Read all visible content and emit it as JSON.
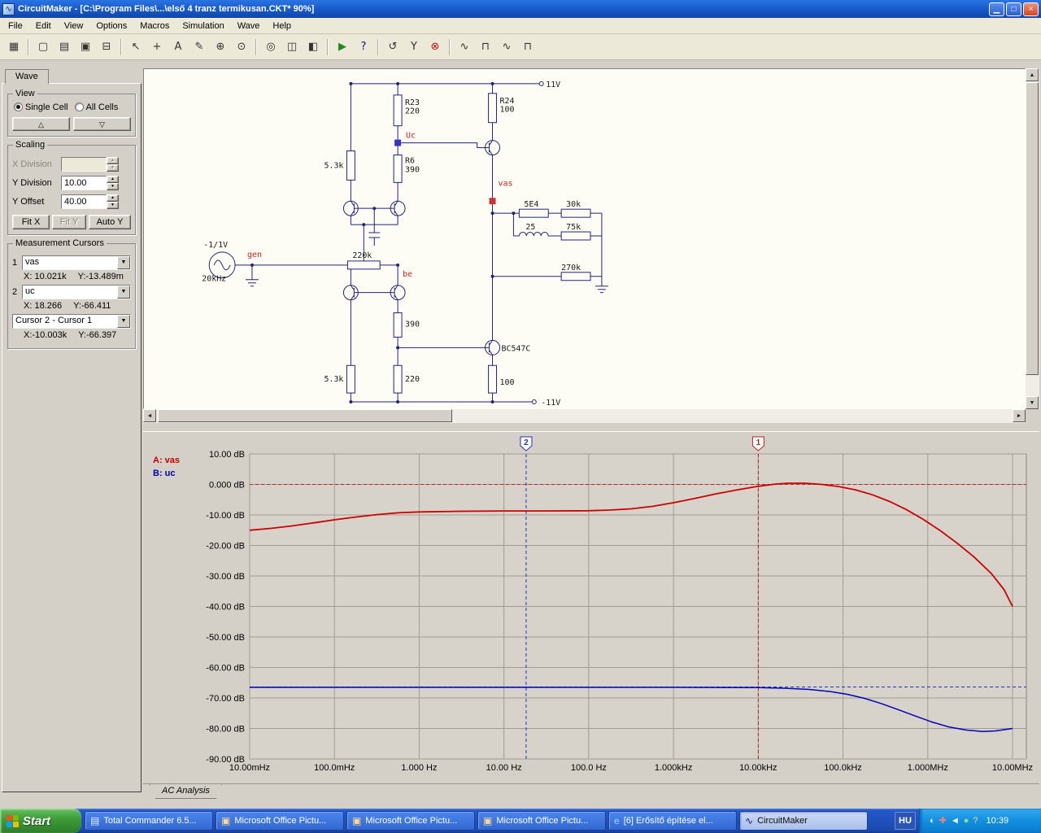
{
  "window": {
    "title": "CircuitMaker - [C:\\Program Files\\...\\első 4 tranz termikusan.CKT* 90%]",
    "minimize_glyph": "▁",
    "maximize_glyph": "□",
    "close_glyph": "×",
    "app_icon_glyph": "∿"
  },
  "menu": {
    "items": [
      "File",
      "Edit",
      "View",
      "Options",
      "Macros",
      "Simulation",
      "Wave",
      "Help"
    ]
  },
  "toolbar": {
    "buttons": [
      {
        "name": "board",
        "glyph": "▦"
      },
      {
        "sep": true
      },
      {
        "name": "new-file",
        "glyph": "▢"
      },
      {
        "name": "open-file",
        "glyph": "▤"
      },
      {
        "name": "save-file",
        "glyph": "▣"
      },
      {
        "name": "print",
        "glyph": "⊟"
      },
      {
        "sep": true
      },
      {
        "name": "select-arrow",
        "glyph": "↖"
      },
      {
        "name": "wire-tool",
        "glyph": "+"
      },
      {
        "name": "text-tool",
        "glyph": "A"
      },
      {
        "name": "edit-tool",
        "glyph": "✎"
      },
      {
        "name": "zoom-in-tool",
        "glyph": "⊕"
      },
      {
        "name": "zoom-tool",
        "glyph": "⊙"
      },
      {
        "sep": true
      },
      {
        "name": "find-part",
        "glyph": "◎"
      },
      {
        "name": "page-view",
        "glyph": "◫"
      },
      {
        "name": "split-view",
        "glyph": "◧"
      },
      {
        "sep": true
      },
      {
        "name": "run-simulation",
        "glyph": "▶",
        "color": "#1f8a1f"
      },
      {
        "name": "help",
        "glyph": "?",
        "color": "#14138a"
      },
      {
        "sep": true
      },
      {
        "name": "reset-simulation",
        "glyph": "↺"
      },
      {
        "name": "probe-y",
        "glyph": "Y"
      },
      {
        "name": "stop-simulation",
        "glyph": "⊗",
        "color": "#cc1111"
      },
      {
        "sep": true
      },
      {
        "name": "waveform-analog",
        "glyph": "∿"
      },
      {
        "name": "waveform-digital",
        "glyph": "⊓"
      },
      {
        "name": "waveform-mixed",
        "glyph": "∿"
      },
      {
        "name": "waveform-scope",
        "glyph": "⊓"
      }
    ]
  },
  "sidebar": {
    "tab_label": "Wave",
    "view": {
      "title": "View",
      "single_cell": "Single Cell",
      "all_cells": "All Cells",
      "up_glyph": "△",
      "down_glyph": "▽"
    },
    "scaling": {
      "title": "Scaling",
      "x_division_label": "X Division",
      "x_division_value": "",
      "y_division_label": "Y Division",
      "y_division_value": "10.00",
      "y_offset_label": "Y Offset",
      "y_offset_value": "40.00",
      "fit_x": "Fit X",
      "fit_y": "Fit Y",
      "auto_y": "Auto Y",
      "spin_up_glyph": "▲",
      "spin_down_glyph": "▼"
    },
    "cursors": {
      "title": "Measurement Cursors",
      "c1_index": "1",
      "c1_signal": "vas",
      "c1_x": "X: 10.021k",
      "c1_y": "Y:-13.489m",
      "c2_index": "2",
      "c2_signal": "uc",
      "c2_x": "X: 18.266",
      "c2_y": "Y:-66.411",
      "diff_label": "Cursor 2 - Cursor 1",
      "diff_x": "X:-10.003k",
      "diff_y": "Y:-66.397",
      "combo_arrow_glyph": "▼"
    }
  },
  "circuit": {
    "labels": {
      "vcc": "11V",
      "vee": "-11V",
      "r23_name": "R23",
      "r23_value": "220",
      "r24_name": "R24",
      "r24_value": "100",
      "r6_name": "R6",
      "r6_value": "390",
      "r_in_top": "5.3k",
      "node_uc": "Uc",
      "node_vas": "vas",
      "node_gen": "gen",
      "node_be": "be",
      "gen_amplitude": "-1/1V",
      "gen_freq": "20kHz",
      "r_220k": "220k",
      "r_5e4": "5E4",
      "r_30k": "30k",
      "l_25": "25",
      "r_75k": "75k",
      "r_270k": "270k",
      "r_390": "390",
      "q_out": "BC547C",
      "r_bot_53k": "5.3k",
      "r_bot_220": "220",
      "r_bot_100": "100"
    }
  },
  "chart_data": {
    "type": "line",
    "title": "AC Analysis frequency response",
    "x_scale": "log",
    "x_log_range": [
      -2,
      7
    ],
    "y_range_db": [
      -90,
      10
    ],
    "grid": true,
    "x_ticks": [
      "10.00mHz",
      "100.0mHz",
      "1.000 Hz",
      "10.00 Hz",
      "100.0 Hz",
      "1.000kHz",
      "10.00kHz",
      "100.0kHz",
      "1.000MHz",
      "10.00MHz"
    ],
    "y_ticks": [
      "10.00 dB",
      "0.000 dB",
      "-10.00 dB",
      "-20.00 dB",
      "-30.00 dB",
      "-40.00 dB",
      "-50.00 dB",
      "-60.00 dB",
      "-70.00 dB",
      "-80.00 dB",
      "-90.00 dB"
    ],
    "series": [
      {
        "name": "A: vas",
        "color": "#cc0000",
        "points": [
          [
            -2,
            -15.0
          ],
          [
            -1.75,
            -14.4
          ],
          [
            -1.5,
            -13.6
          ],
          [
            -1.25,
            -12.6
          ],
          [
            -1,
            -11.6
          ],
          [
            -0.75,
            -10.7
          ],
          [
            -0.5,
            -9.9
          ],
          [
            -0.25,
            -9.3
          ],
          [
            0,
            -9.0
          ],
          [
            0.5,
            -8.8
          ],
          [
            1,
            -8.7
          ],
          [
            1.5,
            -8.7
          ],
          [
            2,
            -8.6
          ],
          [
            2.25,
            -8.4
          ],
          [
            2.5,
            -8.0
          ],
          [
            2.75,
            -7.2
          ],
          [
            3,
            -6.0
          ],
          [
            3.25,
            -4.6
          ],
          [
            3.5,
            -3.1
          ],
          [
            3.75,
            -1.8
          ],
          [
            4,
            -0.6
          ],
          [
            4.2,
            0.1
          ],
          [
            4.35,
            0.4
          ],
          [
            4.55,
            0.4
          ],
          [
            4.75,
            0.0
          ],
          [
            4.95,
            -0.7
          ],
          [
            5.15,
            -1.8
          ],
          [
            5.35,
            -3.4
          ],
          [
            5.55,
            -5.6
          ],
          [
            5.75,
            -8.3
          ],
          [
            5.95,
            -11.5
          ],
          [
            6.15,
            -15.2
          ],
          [
            6.35,
            -19.3
          ],
          [
            6.55,
            -23.9
          ],
          [
            6.75,
            -29.2
          ],
          [
            6.9,
            -34.5
          ],
          [
            7,
            -40.0
          ]
        ]
      },
      {
        "name": "B: uc",
        "color": "#0000bb",
        "points": [
          [
            -2,
            -66.5
          ],
          [
            -1,
            -66.5
          ],
          [
            0,
            -66.5
          ],
          [
            1,
            -66.5
          ],
          [
            2,
            -66.5
          ],
          [
            3,
            -66.5
          ],
          [
            3.6,
            -66.55
          ],
          [
            4,
            -66.6
          ],
          [
            4.3,
            -66.8
          ],
          [
            4.6,
            -67.2
          ],
          [
            4.85,
            -67.9
          ],
          [
            5.05,
            -68.8
          ],
          [
            5.25,
            -70.1
          ],
          [
            5.45,
            -71.8
          ],
          [
            5.65,
            -73.8
          ],
          [
            5.85,
            -75.9
          ],
          [
            6.05,
            -77.9
          ],
          [
            6.25,
            -79.5
          ],
          [
            6.45,
            -80.5
          ],
          [
            6.65,
            -81.0
          ],
          [
            6.8,
            -80.8
          ],
          [
            7,
            -80.0
          ]
        ]
      }
    ],
    "cursors": [
      {
        "id": "2",
        "signal": "uc",
        "color": "#2233bb",
        "x_log": 1.2617,
        "y_db": -66.411
      },
      {
        "id": "1",
        "signal": "vas",
        "color": "#bb2222",
        "x_log": 4.0009,
        "y_db": -0.0135
      }
    ]
  },
  "plot": {
    "tab_label": "AC Analysis"
  },
  "taskbar": {
    "start_label": "Start",
    "buttons": [
      {
        "label": "Total Commander 6.5...",
        "icon": "▤",
        "icon_color": "#e8eef8"
      },
      {
        "label": "Microsoft Office Pictu...",
        "icon": "▣",
        "icon_color": "#ffd98a"
      },
      {
        "label": "Microsoft Office Pictu...",
        "icon": "▣",
        "icon_color": "#ffd98a"
      },
      {
        "label": "Microsoft Office Pictu...",
        "icon": "▣",
        "icon_color": "#ffd98a"
      },
      {
        "label": "[6] Erősítő építése el...",
        "icon": "e",
        "icon_color": "#9fd2ff"
      },
      {
        "label": "CircuitMaker",
        "icon": "∿",
        "icon_color": "#14138a",
        "active": true
      }
    ],
    "language": "HU",
    "tray_icons": [
      {
        "name": "display-icon",
        "glyph": "◐",
        "color": "#e8eef8"
      },
      {
        "name": "alert-icon",
        "glyph": "✚",
        "color": "#ff7b6b"
      },
      {
        "name": "volume-icon",
        "glyph": "◄",
        "color": "#ffffff"
      },
      {
        "name": "network-icon",
        "glyph": "●",
        "color": "#8fe08f"
      },
      {
        "name": "help-icon",
        "glyph": "?",
        "color": "#ffd96b"
      }
    ],
    "time": "10:39"
  }
}
